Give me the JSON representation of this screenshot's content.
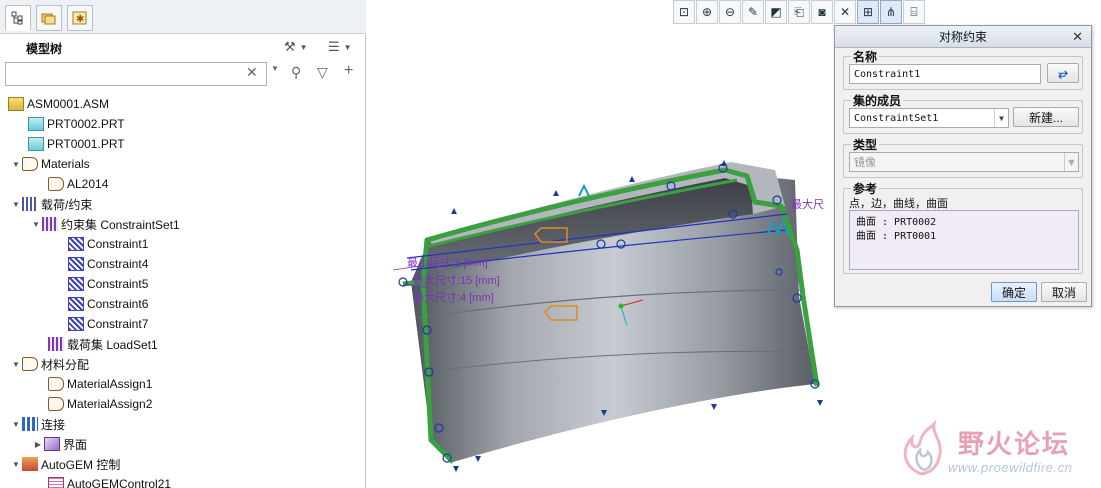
{
  "model_tree": {
    "title": "模型树",
    "search_placeholder": "",
    "items": [
      {
        "label": "ASM0001.ASM",
        "icon": "assembly-icon"
      },
      {
        "label": "PRT0002.PRT",
        "icon": "part-icon"
      },
      {
        "label": "PRT0001.PRT",
        "icon": "part-icon"
      },
      {
        "label": "Materials",
        "icon": "materials-icon"
      },
      {
        "label": "AL2014",
        "icon": "material-icon"
      },
      {
        "label": "载荷/约束",
        "icon": "loads-constraints-icon"
      },
      {
        "label": "约束集 ConstraintSet1",
        "icon": "constraint-set-icon"
      },
      {
        "label": "Constraint1",
        "icon": "constraint-icon"
      },
      {
        "label": "Constraint4",
        "icon": "constraint-icon"
      },
      {
        "label": "Constraint5",
        "icon": "constraint-icon"
      },
      {
        "label": "Constraint6",
        "icon": "constraint-icon"
      },
      {
        "label": "Constraint7",
        "icon": "constraint-icon"
      },
      {
        "label": "载荷集 LoadSet1",
        "icon": "load-set-icon"
      },
      {
        "label": "材料分配",
        "icon": "material-assignment-icon"
      },
      {
        "label": "MaterialAssign1",
        "icon": "material-assign-icon"
      },
      {
        "label": "MaterialAssign2",
        "icon": "material-assign-icon"
      },
      {
        "label": "连接",
        "icon": "connections-icon"
      },
      {
        "label": "界面",
        "icon": "interface-icon"
      },
      {
        "label": "AutoGEM 控制",
        "icon": "autogem-icon"
      },
      {
        "label": "AutoGEMControl21",
        "icon": "autogem-control-icon"
      }
    ]
  },
  "dialog": {
    "title": "对称约束",
    "name_label": "名称",
    "name_value": "Constraint1",
    "member_label": "集的成员",
    "member_value": "ConstraintSet1",
    "new_button": "新建...",
    "type_label": "类型",
    "type_value": "镜像",
    "ref_label": "参考",
    "ref_hint": "点，边，曲线，曲面",
    "refs": [
      "曲面 : PRT0002",
      "曲面 : PRT0001"
    ],
    "ok": "确定",
    "cancel": "取消"
  },
  "viewport_labels": {
    "dim1": "最小尺寸:3 [mm]",
    "dim2": "最大尺寸:15 [mm]",
    "dim3": "最大尺寸:4 [mm]",
    "dim_right": "最大尺"
  },
  "watermark": {
    "title": "野火论坛",
    "url": "www.proewildfire.cn"
  },
  "colors": {
    "accent": "#5b8fce",
    "model_green": "#3aa040",
    "part_gray": "#8e9299",
    "label_purple": "#7a32c0"
  }
}
